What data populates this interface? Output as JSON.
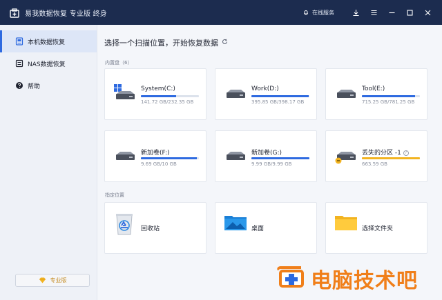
{
  "window": {
    "title": "易我数据恢复 专业版 终身",
    "online_service": "在线服务"
  },
  "sidebar": {
    "items": [
      {
        "label": "本机数据恢复",
        "icon": "local-recovery-icon",
        "active": true
      },
      {
        "label": "NAS数据恢复",
        "icon": "nas-icon",
        "active": false
      },
      {
        "label": "帮助",
        "icon": "help-icon",
        "active": false
      }
    ],
    "pro_label": "专业版"
  },
  "main": {
    "title": "选择一个扫描位置，开始恢复数据",
    "drives_label": "内置盘（6）",
    "locations_label": "指定位置",
    "drives": [
      {
        "name": "System(C:)",
        "size": "141.72 GB/232.35 GB",
        "usage": 0.61
      },
      {
        "name": "Work(D:)",
        "size": "395.85 GB/398.17 GB",
        "usage": 0.99
      },
      {
        "name": "Tool(E:)",
        "size": "715.25 GB/781.25 GB",
        "usage": 0.92
      },
      {
        "name": "新加卷(F:)",
        "size": "9.69 GB/10 GB",
        "usage": 0.97
      },
      {
        "name": "新加卷(G:)",
        "size": "9.99 GB/9.99 GB",
        "usage": 1.0
      },
      {
        "name": "丢失的分区 -1",
        "size": "663.59 GB",
        "usage": 1.0
      }
    ],
    "locations": [
      {
        "name": "回收站",
        "icon": "recycle-bin-icon"
      },
      {
        "name": "桌面",
        "icon": "desktop-icon"
      },
      {
        "name": "选择文件夹",
        "icon": "folder-icon"
      }
    ]
  },
  "watermark": {
    "text": "电脑技术吧"
  },
  "colors": {
    "titlebar": "#1c2c4f",
    "accent": "#2e6ae0",
    "warning": "#f2b320",
    "watermark": "#f07f1a"
  }
}
